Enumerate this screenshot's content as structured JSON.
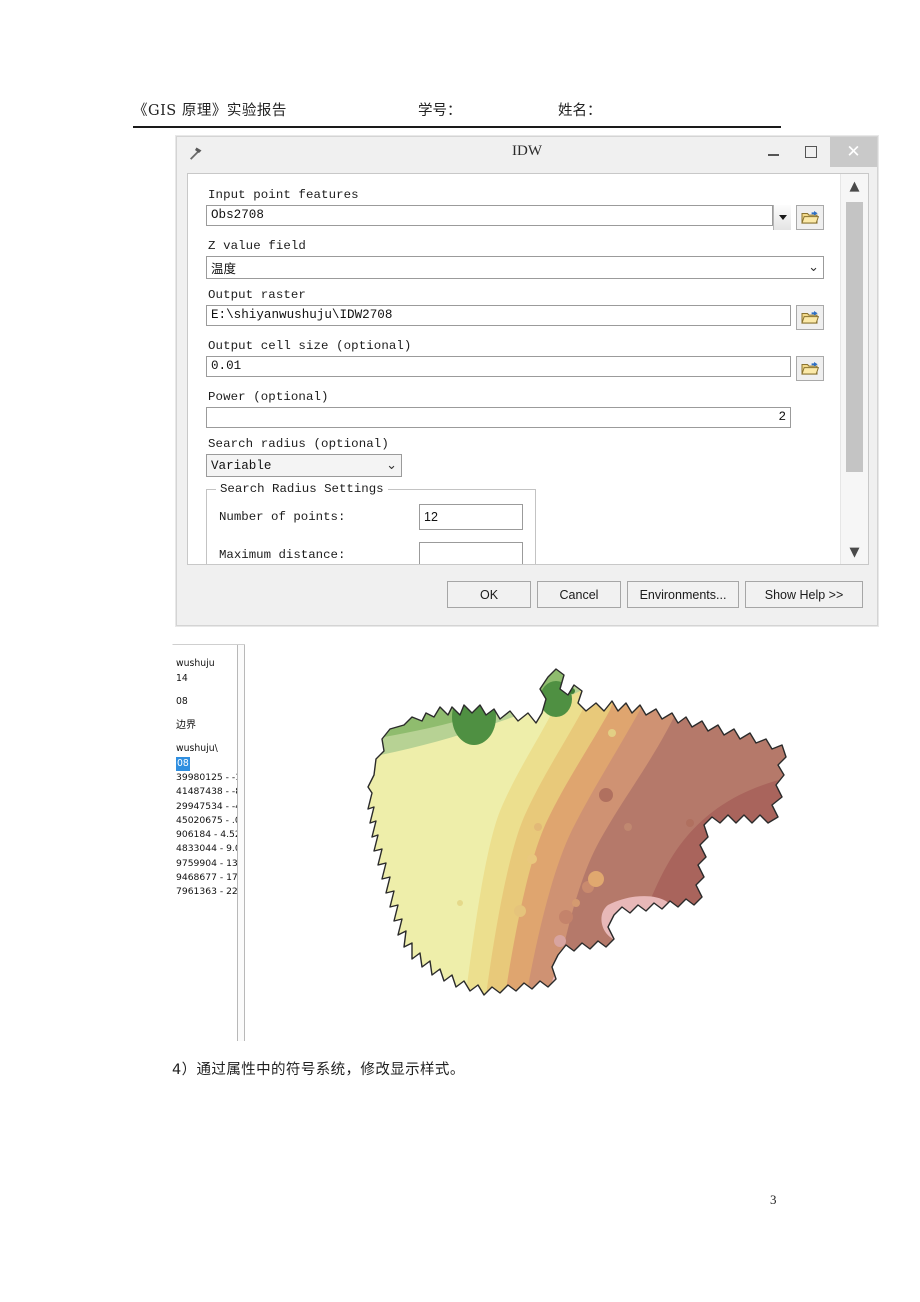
{
  "document": {
    "header": {
      "title": "《GIS 原理》实验报告",
      "student_id_label": "学号：",
      "name_label": "姓名："
    },
    "caption": "4）通过属性中的符号系统，修改显示样式。",
    "page_number": "3"
  },
  "dialog": {
    "title": "IDW",
    "tool_icon": "hammer-icon",
    "window_controls": {
      "minimize": "minimize-icon",
      "maximize": "maximize-icon",
      "close": "✕"
    },
    "fields": [
      {
        "label": "Input point features",
        "value": "Obs2708",
        "control": "combobox-with-browse",
        "browse_icon": "open-folder-icon"
      },
      {
        "label": "Z value field",
        "value": "温度",
        "control": "dropdown"
      },
      {
        "label": "Output raster",
        "value": "E:\\shiyanwushuju\\IDW2708",
        "control": "text-with-browse",
        "browse_icon": "open-folder-icon"
      },
      {
        "label": "Output cell size (optional)",
        "value": "0.01",
        "control": "text-with-browse",
        "browse_icon": "open-folder-icon"
      },
      {
        "label": "Power (optional)",
        "value": "2",
        "control": "text-right-aligned"
      },
      {
        "label": "Search radius (optional)",
        "value": "Variable",
        "control": "dropdown-narrow"
      }
    ],
    "search_radius_settings": {
      "group_title": "Search Radius Settings",
      "rows": [
        {
          "label": "Number of points:",
          "value": "12"
        },
        {
          "label": "Maximum distance:",
          "value": ""
        }
      ]
    },
    "scrollbar": {
      "up_arrow": "chevron-up-icon",
      "down_arrow": "chevron-down-icon"
    },
    "buttons": {
      "ok": "OK",
      "cancel": "Cancel",
      "environments": "Environments...",
      "show_help": "Show Help >>"
    }
  },
  "toc": {
    "entries": [
      {
        "text": "wushuju",
        "type": "layer"
      },
      {
        "text": "14",
        "type": "layer"
      },
      {
        "text": "",
        "type": "gap"
      },
      {
        "text": "08",
        "type": "layer"
      },
      {
        "text": "",
        "type": "gap"
      },
      {
        "text": "边界",
        "type": "layer-cjk"
      },
      {
        "text": "",
        "type": "gap"
      },
      {
        "text": "wushuju\\",
        "type": "layer"
      },
      {
        "text": "08",
        "type": "layer-selected"
      }
    ],
    "classes": [
      "39980125 - -1",
      "41487438 - -8",
      "29947534 - -4",
      "45020675 - .0",
      "906184 - 4.52",
      "4833044 - 9.0",
      "9759904 - 13",
      "9468677 - 17",
      "7961363 - 22"
    ]
  },
  "map": {
    "title": "IDW interpolated temperature surface of Sichuan",
    "colors": {
      "dark_green": "#4f9042",
      "green": "#8fbc6e",
      "light_green": "#b7d294",
      "pale_yellow": "#eeeeaa",
      "yellow": "#ecdf8e",
      "gold": "#e8c97a",
      "orange": "#dfa56f",
      "tan": "#cf9273",
      "brown": "#b5796a",
      "dark_brown": "#a9645c",
      "pink": "#e8b8b8",
      "outline": "#2b2b2b",
      "background": "#ffffff"
    }
  }
}
